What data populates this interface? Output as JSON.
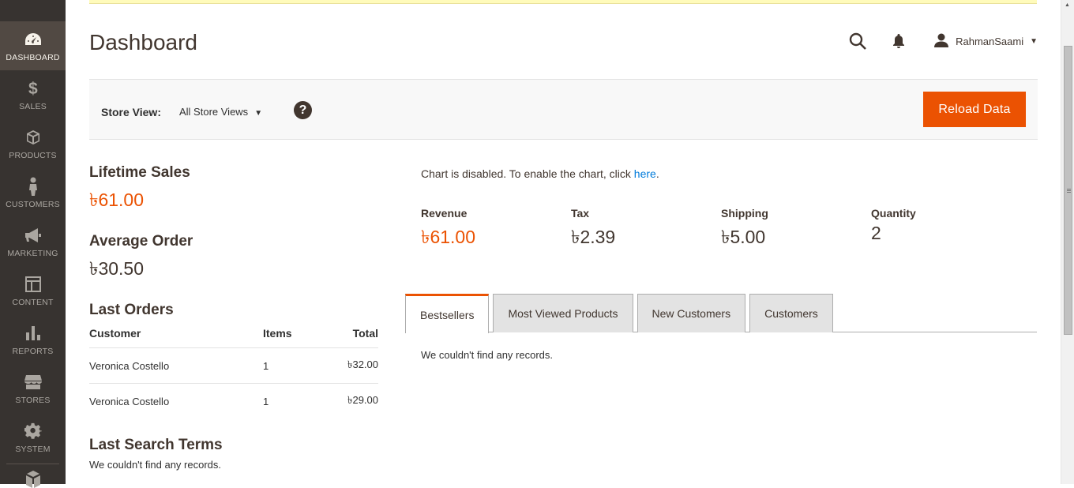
{
  "sidebar": {
    "items": [
      {
        "label": "DASHBOARD",
        "icon": "dashboard-icon",
        "active": true
      },
      {
        "label": "SALES",
        "icon": "dollar-icon"
      },
      {
        "label": "PRODUCTS",
        "icon": "box-icon"
      },
      {
        "label": "CUSTOMERS",
        "icon": "person-icon"
      },
      {
        "label": "MARKETING",
        "icon": "megaphone-icon"
      },
      {
        "label": "CONTENT",
        "icon": "layout-icon"
      },
      {
        "label": "REPORTS",
        "icon": "bar-chart-icon"
      },
      {
        "label": "STORES",
        "icon": "storefront-icon"
      },
      {
        "label": "SYSTEM",
        "icon": "gear-icon"
      }
    ]
  },
  "header": {
    "title": "Dashboard",
    "user": "RahmanSaami"
  },
  "store_bar": {
    "label": "Store View:",
    "selected": "All Store Views",
    "help": "?",
    "reload_label": "Reload Data"
  },
  "lifetime_sales": {
    "title": "Lifetime Sales",
    "value": "৳61.00"
  },
  "average_order": {
    "title": "Average Order",
    "value": "৳30.50"
  },
  "last_orders": {
    "title": "Last Orders",
    "headers": {
      "customer": "Customer",
      "items": "Items",
      "total": "Total"
    },
    "rows": [
      {
        "customer": "Veronica Costello",
        "items": "1",
        "total": "৳32.00"
      },
      {
        "customer": "Veronica Costello",
        "items": "1",
        "total": "৳29.00"
      }
    ]
  },
  "last_search_terms": {
    "title": "Last Search Terms",
    "empty": "We couldn't find any records."
  },
  "chart": {
    "message": "Chart is disabled. To enable the chart, click ",
    "link": "here",
    "suffix": "."
  },
  "totals": [
    {
      "label": "Revenue",
      "value": "৳61.00"
    },
    {
      "label": "Tax",
      "value": "৳2.39"
    },
    {
      "label": "Shipping",
      "value": "৳5.00"
    },
    {
      "label": "Quantity",
      "value": "2"
    }
  ],
  "tabs": [
    {
      "label": "Bestsellers",
      "active": true
    },
    {
      "label": "Most Viewed Products"
    },
    {
      "label": "New Customers"
    },
    {
      "label": "Customers"
    }
  ],
  "tab_content": {
    "empty": "We couldn't find any records."
  },
  "colors": {
    "accent": "#eb5202",
    "sidebar": "#373330",
    "link": "#007bdb"
  }
}
